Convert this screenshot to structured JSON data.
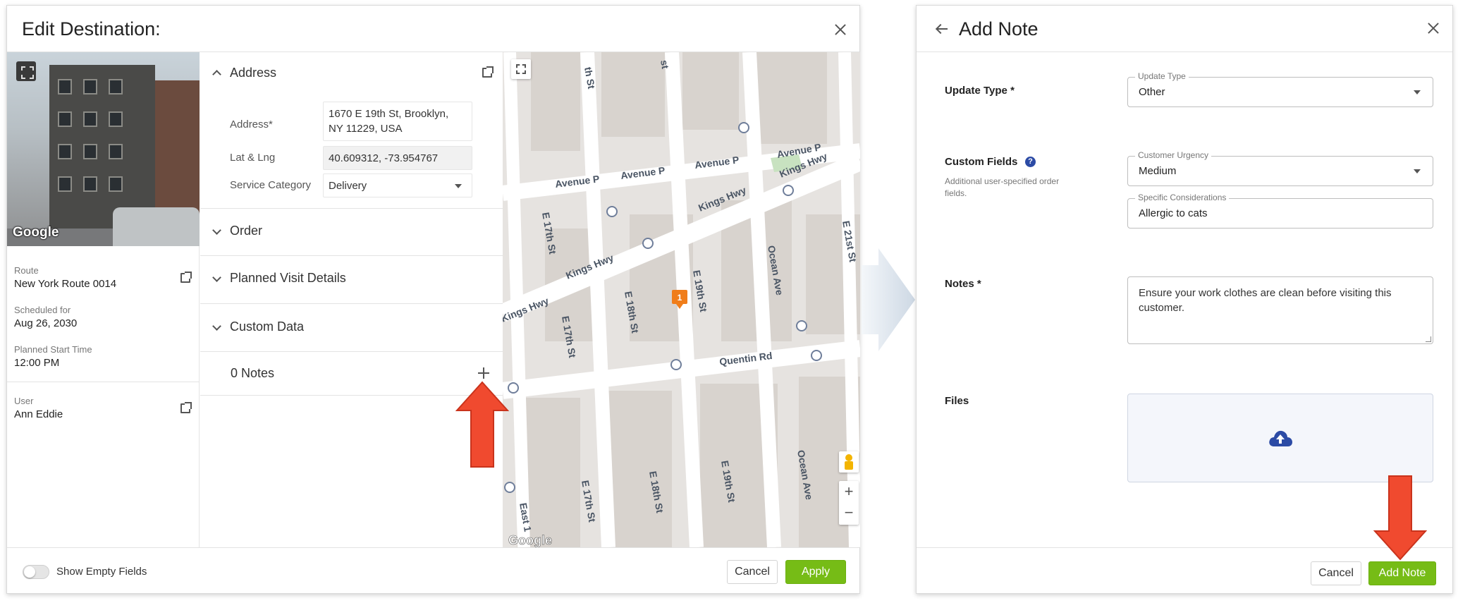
{
  "edit_destination": {
    "title": "Edit Destination:",
    "route_label": "Route",
    "route_value": "New York Route 0014",
    "scheduled_label": "Scheduled for",
    "scheduled_value": "Aug 26, 2030",
    "start_label": "Planned Start Time",
    "start_value": "12:00 PM",
    "user_label": "User",
    "user_value": "Ann Eddie",
    "photo_watermark": "Google",
    "sections": {
      "address": "Address",
      "order": "Order",
      "planned_visit": "Planned Visit Details",
      "custom_data": "Custom Data",
      "notes": "0 Notes"
    },
    "fields": {
      "address_label": "Address*",
      "address_line1": "1670 E 19th St, Brooklyn,",
      "address_line2": "NY 11229, USA",
      "latlng_label": "Lat & Lng",
      "latlng_value": "40.609312, -73.954767",
      "service_label": "Service Category",
      "service_value": "Delivery"
    },
    "map": {
      "watermark": "Google",
      "marker_number": "1",
      "streets": [
        "Avenue P",
        "Avenue P",
        "Avenue P",
        "Avenue P",
        "Kings Hwy",
        "Kings Hwy",
        "Kings Hwy",
        "Kings Hwy",
        "E 17th St",
        "E 17th St",
        "E 18th St",
        "E 19th St",
        "E 21st St",
        "Ocean Ave",
        "Quentin Rd",
        "E 17th St",
        "E 18th St",
        "E 19th St",
        "Ocean Ave",
        "East 1",
        "th St",
        "st"
      ]
    },
    "footer": {
      "toggle_label": "Show Empty Fields",
      "cancel": "Cancel",
      "apply": "Apply"
    }
  },
  "add_note": {
    "title": "Add Note",
    "update_type_label": "Update Type *",
    "update_type_legend": "Update Type",
    "update_type_value": "Other",
    "custom_fields_label": "Custom Fields",
    "custom_fields_help": "?",
    "custom_fields_sub": "Additional user-specified order fields.",
    "urgency_legend": "Customer Urgency",
    "urgency_value": "Medium",
    "considerations_legend": "Specific Considerations",
    "considerations_value": "Allergic to cats",
    "notes_label": "Notes *",
    "notes_value": "Ensure your work clothes are clean before visiting this customer.",
    "files_label": "Files",
    "cancel": "Cancel",
    "submit": "Add Note"
  },
  "colors": {
    "accent_green": "#76bc16",
    "arrow_red": "#f04a2f",
    "marker_orange": "#f07d1a",
    "help_blue": "#2c4ba5"
  }
}
